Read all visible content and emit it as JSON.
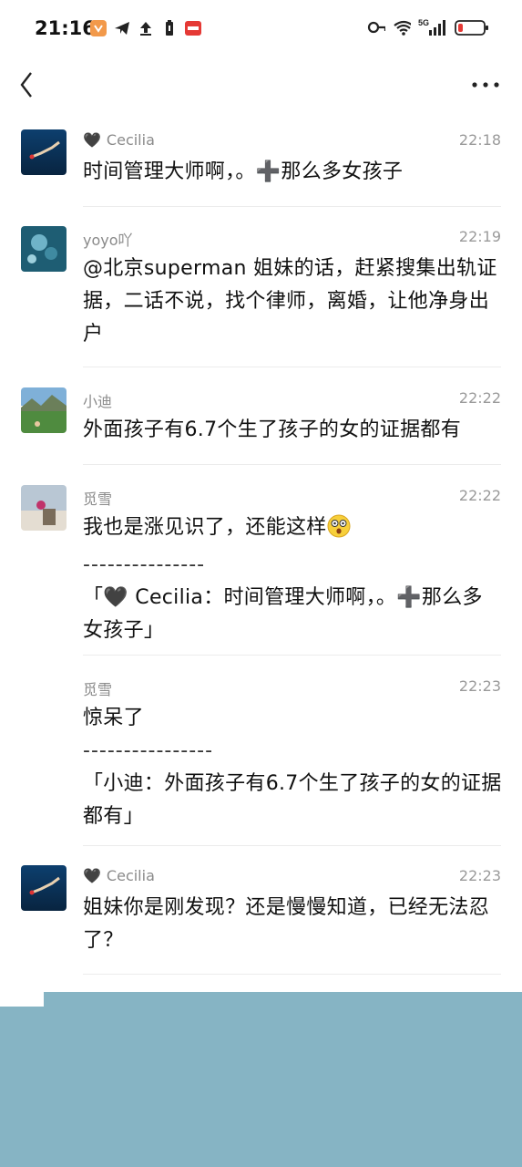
{
  "status_bar": {
    "time": "21:16",
    "left_icons": [
      "app-badge-icon",
      "telegram-icon",
      "upload-icon",
      "battery-saver-icon",
      "news-app-icon"
    ],
    "right_icons": [
      "key-icon",
      "wifi-icon",
      "signal-5g-icon",
      "battery-low-icon"
    ],
    "network_label": "5G"
  },
  "nav": {
    "back_icon": "chevron-left-icon",
    "more_icon": "more-dots-icon"
  },
  "messages": [
    {
      "name": "Cecilia",
      "heart": "🖤",
      "time": "22:18",
      "body": "时间管理大师啊，。➕那么多女孩子"
    },
    {
      "name": "yoyo吖",
      "time": "22:19",
      "body": "@北京superman 姐妹的话，赶紧搜集出轨证据，二话不说，找个律师，离婚，让他净身出户"
    },
    {
      "name": "小迪",
      "time": "22:22",
      "body": "外面孩子有6.7个生了孩子的女的证据都有"
    },
    {
      "name": "觅雪",
      "time": "22:22",
      "body": "我也是涨见识了，还能这样",
      "separator": "---------------",
      "quote": "「🖤 Cecilia：时间管理大师啊，。➕那么多女孩子」"
    },
    {
      "name": "觅雪",
      "time": "22:23",
      "body": "惊呆了",
      "separator": "----------------",
      "quote": "「小迪：外面孩子有6.7个生了孩子的女的证据都有」"
    },
    {
      "name": "Cecilia",
      "heart": "🖤",
      "time": "22:23",
      "body": "姐妹你是刚发现？还是慢慢知道，已经无法忍了？"
    }
  ],
  "colors": {
    "name_gray": "#8a8a8a",
    "text": "#111111",
    "separator": "#ececec",
    "overlay_block": "#86b4c4"
  }
}
